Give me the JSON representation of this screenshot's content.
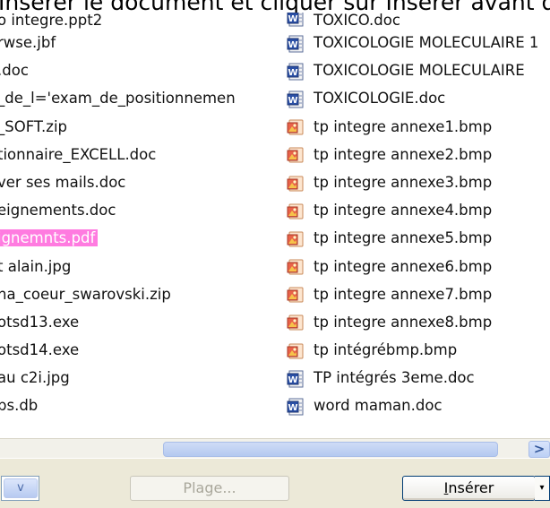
{
  "banner_text": "Insérer le document et cliquer sur Insérer avant d'ajouter votre document à votre envoi",
  "left_files": [
    {
      "name": "o integre.ppt2"
    },
    {
      "name": "rwse.jbf"
    },
    {
      "name": ".doc"
    },
    {
      "name": "_de_l='exam_de_positionnemen"
    },
    {
      "name": "_SOFT.zip"
    },
    {
      "name": "tionnaire_EXCELL.doc"
    },
    {
      "name": "ver ses mails.doc"
    },
    {
      "name": "eignements.doc"
    },
    {
      "name": "ignemnts.pdf",
      "selected": true
    },
    {
      "name": "t alain.jpg"
    },
    {
      "name": "na_coeur_swarovski.zip"
    },
    {
      "name": "otsd13.exe"
    },
    {
      "name": "otsd14.exe"
    },
    {
      "name": "au c2i.jpg"
    },
    {
      "name": "bs.db"
    }
  ],
  "right_files": [
    {
      "name": "TOXICO.doc",
      "icon": "word-doc-icon"
    },
    {
      "name": "TOXICOLOGIE MOLECULAIRE 1",
      "icon": "word-doc-icon"
    },
    {
      "name": "TOXICOLOGIE MOLECULAIRE",
      "icon": "word-doc-icon"
    },
    {
      "name": "TOXICOLOGIE.doc",
      "icon": "word-doc-icon"
    },
    {
      "name": "tp integre annexe1.bmp",
      "icon": "bitmap-image-icon"
    },
    {
      "name": "tp integre annexe2.bmp",
      "icon": "bitmap-image-icon"
    },
    {
      "name": "tp integre annexe3.bmp",
      "icon": "bitmap-image-icon"
    },
    {
      "name": "tp integre annexe4.bmp",
      "icon": "bitmap-image-icon"
    },
    {
      "name": "tp integre annexe5.bmp",
      "icon": "bitmap-image-icon"
    },
    {
      "name": "tp integre annexe6.bmp",
      "icon": "bitmap-image-icon"
    },
    {
      "name": "tp integre annexe7.bmp",
      "icon": "bitmap-image-icon"
    },
    {
      "name": "tp integre annexe8.bmp",
      "icon": "bitmap-image-icon"
    },
    {
      "name": "tp intégrébmp.bmp",
      "icon": "bitmap-image-icon"
    },
    {
      "name": "TP intégrés 3eme.doc",
      "icon": "word-doc-icon"
    },
    {
      "name": "word maman.doc",
      "icon": "word-doc-icon"
    }
  ],
  "scroll": {
    "right_arrow": ">"
  },
  "footer": {
    "dropdown_arrow": "v",
    "plage_label": "Plage...",
    "insert_label_u": "I",
    "insert_label_rest": "nsérer",
    "split_arrow": "▾"
  },
  "colors": {
    "selection": "#ff7be0",
    "xp_blue": "#b4c9f0",
    "dialog_bg": "#ece9d8"
  }
}
